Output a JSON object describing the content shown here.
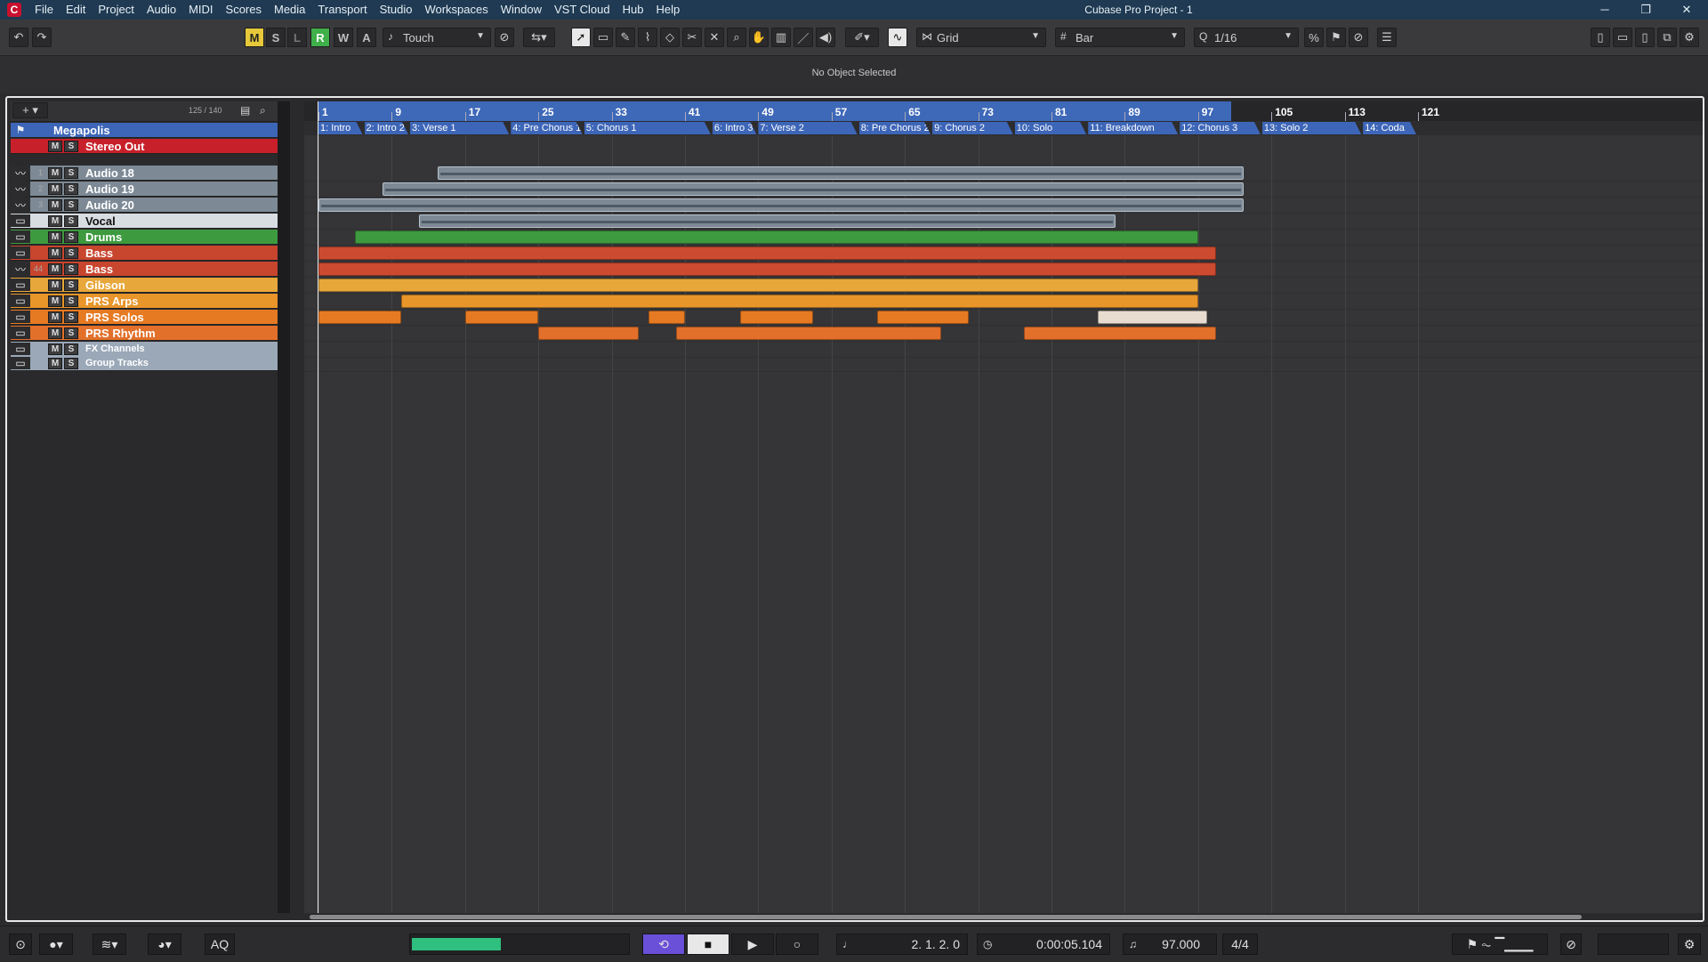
{
  "app": {
    "window_title": "Cubase Pro Project - 1",
    "menu": [
      "File",
      "Edit",
      "Project",
      "Audio",
      "MIDI",
      "Scores",
      "Media",
      "Transport",
      "Studio",
      "Workspaces",
      "Window",
      "VST Cloud",
      "Hub",
      "Help"
    ]
  },
  "toolbar": {
    "modes": [
      "M",
      "S",
      "L",
      "R",
      "W",
      "A"
    ],
    "automation_mode": "Touch",
    "snap_type": "Grid",
    "grid_type": "Bar",
    "quantize": "1/16"
  },
  "info_line": {
    "message": "No Object Selected"
  },
  "track_list": {
    "track_count": "125 / 140",
    "tracks": [
      {
        "name": "Megapolis",
        "num": "",
        "type": "marker"
      },
      {
        "name": "Stereo Out",
        "num": "",
        "type": "output"
      },
      {
        "name": "Audio 18",
        "num": "1",
        "type": "audio"
      },
      {
        "name": "Audio 19",
        "num": "2",
        "type": "audio"
      },
      {
        "name": "Audio 20",
        "num": "3",
        "type": "audio"
      },
      {
        "name": "Vocal",
        "num": "",
        "type": "folder"
      },
      {
        "name": "Drums",
        "num": "",
        "type": "folder"
      },
      {
        "name": "Bass",
        "num": "",
        "type": "folder"
      },
      {
        "name": "Bass",
        "num": "44",
        "type": "audio"
      },
      {
        "name": "Gibson",
        "num": "",
        "type": "folder"
      },
      {
        "name": "PRS Arps",
        "num": "",
        "type": "folder"
      },
      {
        "name": "PRS Solos",
        "num": "",
        "type": "folder"
      },
      {
        "name": "PRS Rhythm",
        "num": "",
        "type": "folder"
      },
      {
        "name": "FX Channels",
        "num": "",
        "type": "folder"
      },
      {
        "name": "Group Tracks",
        "num": "",
        "type": "folder"
      }
    ],
    "mute_label": "M",
    "solo_label": "S"
  },
  "ruler": {
    "bars": [
      "1",
      "9",
      "17",
      "25",
      "33",
      "41",
      "49",
      "57",
      "65",
      "73",
      "81",
      "89",
      "97",
      "105",
      "113",
      "121"
    ]
  },
  "markers": [
    "1: Intro",
    "2: Intro 2",
    "3: Verse 1",
    "4: Pre Chorus 1",
    "5: Chorus 1",
    "6: Intro 3",
    "7: Verse 2",
    "8: Pre Chorus 2",
    "9: Chorus 2",
    "10: Solo",
    "11: Breakdown",
    "12: Chorus 3",
    "13: Solo 2",
    "14: Coda"
  ],
  "colors": {
    "marker_blue": "#3d66b8",
    "stereo_out": "#c8202a",
    "audio": "#7d8a96",
    "vocal": "#d8dde2",
    "drums": "#3e9a3e",
    "bass": "#c8452e",
    "gibson": "#e8a73a",
    "prs_arps": "#e8952a",
    "prs_solos": "#e67a22",
    "prs_rhythm": "#e2702a",
    "fx": "#9aa8b8"
  },
  "transport": {
    "position_bars": "2. 1. 2.   0",
    "position_time": "0:00:05.104",
    "tempo": "97.000",
    "signature": "4/4",
    "aq_label": "AQ"
  }
}
